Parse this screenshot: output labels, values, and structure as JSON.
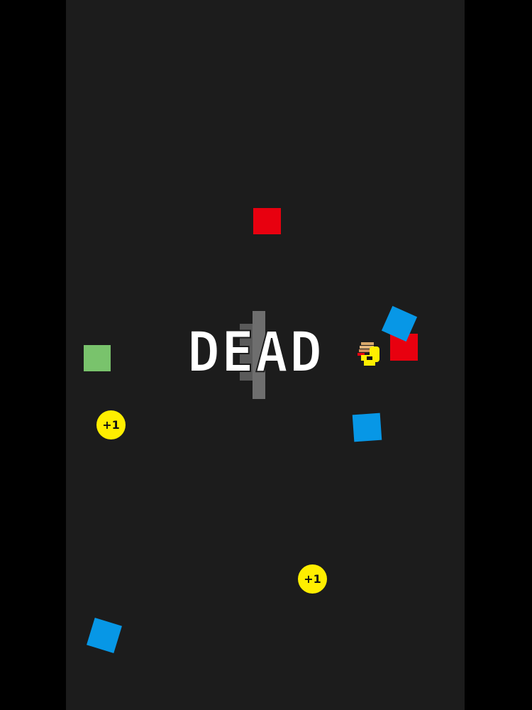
{
  "game": {
    "status_text": "DEAD",
    "coin_label": "+1"
  },
  "colors": {
    "background": "#000000",
    "play_area": "#1c1c1c",
    "hazard_red": "#e8000f",
    "hazard_blue": "#0797e6",
    "goal_green": "#79c36c",
    "coin_yellow": "#ffee00",
    "wall_gray": "#6e6e6e",
    "text_white": "#ffffff"
  },
  "objects": {
    "red_blocks": 2,
    "blue_blocks": 3,
    "green_blocks": 1,
    "coins": 2
  }
}
